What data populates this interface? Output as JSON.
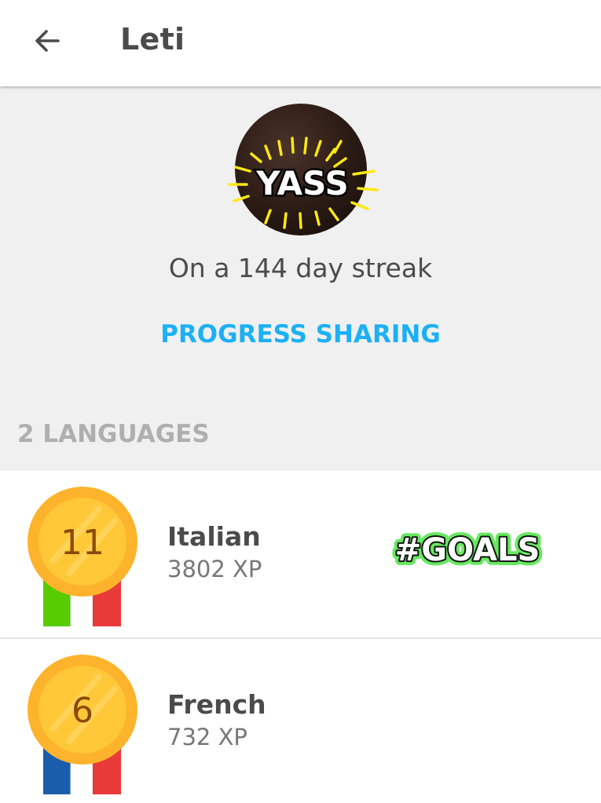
{
  "header": {
    "title": "Leti",
    "back_icon": "arrow-left-icon"
  },
  "profile": {
    "avatar_sticker_text": "YASS",
    "streak_text": "On a 144 day streak",
    "progress_sharing_label": "PROGRESS SHARING"
  },
  "languages": {
    "count_label": "2 LANGUAGES",
    "items": [
      {
        "level": "11",
        "name": "Italian",
        "xp": "3802 XP",
        "flag": "italy"
      },
      {
        "level": "6",
        "name": "French",
        "xp": "732 XP",
        "flag": "france"
      }
    ],
    "sticker_text": "#GOALS"
  },
  "colors": {
    "accent_blue": "#1cb0f6",
    "medal_gold": "#fdb32b",
    "text_dark": "#4b4b4b",
    "text_gray": "#777777",
    "section_gray": "#afafaf"
  }
}
